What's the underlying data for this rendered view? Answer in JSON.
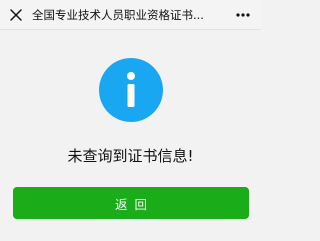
{
  "header": {
    "close_icon": "close-icon",
    "title": "全国专业技术人员职业资格证书...",
    "more_icon": "more-horizontal-icon"
  },
  "main": {
    "status_icon": "info-icon",
    "message": "未查询到证书信息!",
    "back_label": "返回"
  },
  "colors": {
    "info_blue": "#1aa7f2",
    "button_green": "#1aad19"
  }
}
